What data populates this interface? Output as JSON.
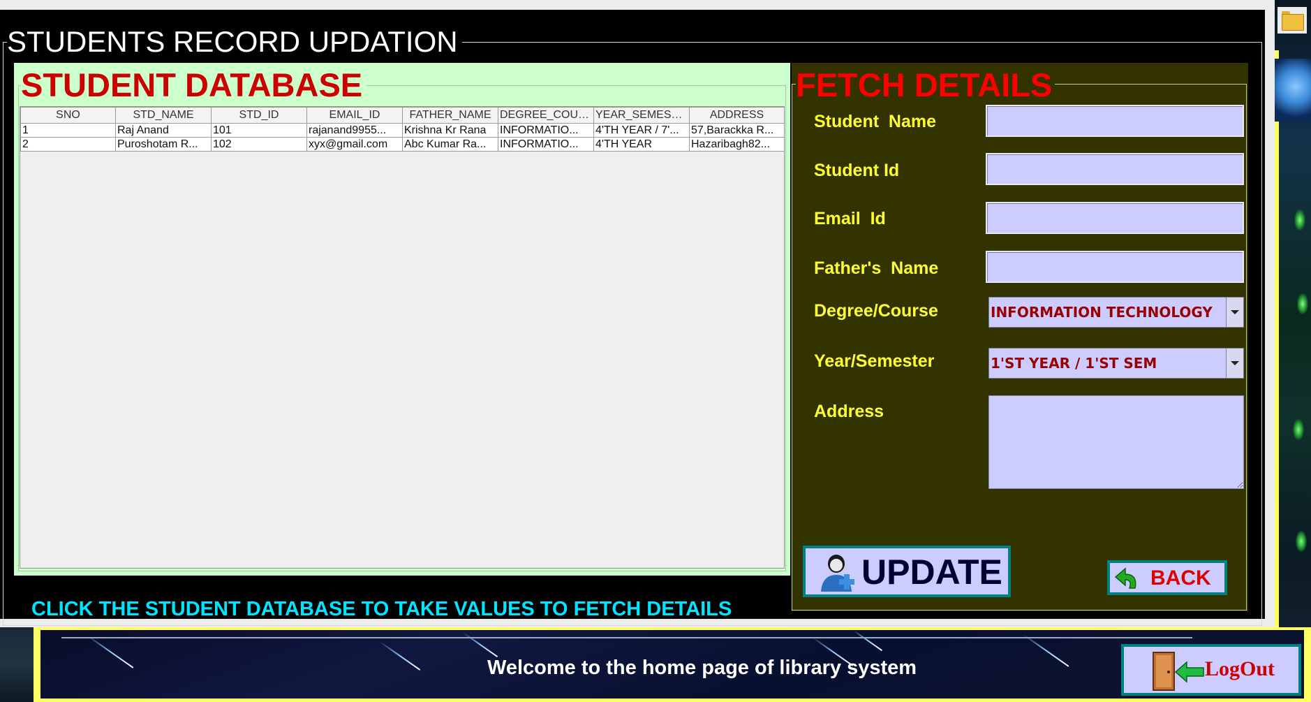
{
  "window": {
    "title": "STUDENTS RECORD UPDATION"
  },
  "database": {
    "title": "STUDENT DATABASE",
    "columns": [
      "SNO",
      "STD_NAME",
      "STD_ID",
      "EMAIL_ID",
      "FATHER_NAME",
      "DEGREE_COUR...",
      "YEAR_SEMESTER",
      "ADDRESS"
    ],
    "rows": [
      [
        "1",
        "Raj Anand",
        "101",
        "rajanand9955...",
        "Krishna Kr Rana",
        "INFORMATIO...",
        "4'TH YEAR / 7'...",
        "57,Barackka R..."
      ],
      [
        "2",
        "Puroshotam R...",
        "102",
        "xyx@gmail.com",
        "Abc Kumar Ra...",
        "INFORMATIO...",
        "4'TH YEAR",
        "Hazaribagh82..."
      ]
    ],
    "hint": "CLICK THE STUDENT DATABASE TO TAKE VALUES TO FETCH DETAILS"
  },
  "fetch": {
    "title": "FETCH DETAILS",
    "labels": {
      "student_name": "Student  Name",
      "student_id": "Student Id",
      "email_id": "Email  Id",
      "fathers_name": "Father's  Name",
      "degree_course": "Degree/Course",
      "year_semester": "Year/Semester",
      "address": "Address"
    },
    "values": {
      "student_name": "",
      "student_id": "",
      "email_id": "",
      "fathers_name": "",
      "degree_course": "INFORMATION TECHNOLOGY",
      "year_semester": "1'ST YEAR / 1'ST SEM",
      "address": ""
    },
    "update_label": "UPDATE",
    "back_label": "BACK"
  },
  "footer": {
    "welcome": "Welcome to the home page of library system",
    "logout_label": "LogOut"
  },
  "icons": {
    "update": "user-add-icon",
    "back": "back-arrow-icon",
    "logout": "door-exit-icon",
    "folder": "folder-icon",
    "dropdown": "chevron-down-icon"
  },
  "colors": {
    "main_bg": "#000000",
    "database_bg": "#ccffcc",
    "fetch_bg": "#333300",
    "field_bg": "#ccccff",
    "label_color": "#ffff33",
    "title_red": "#ff0000",
    "hint_cyan": "#00e5ff",
    "button_border": "#008080"
  }
}
